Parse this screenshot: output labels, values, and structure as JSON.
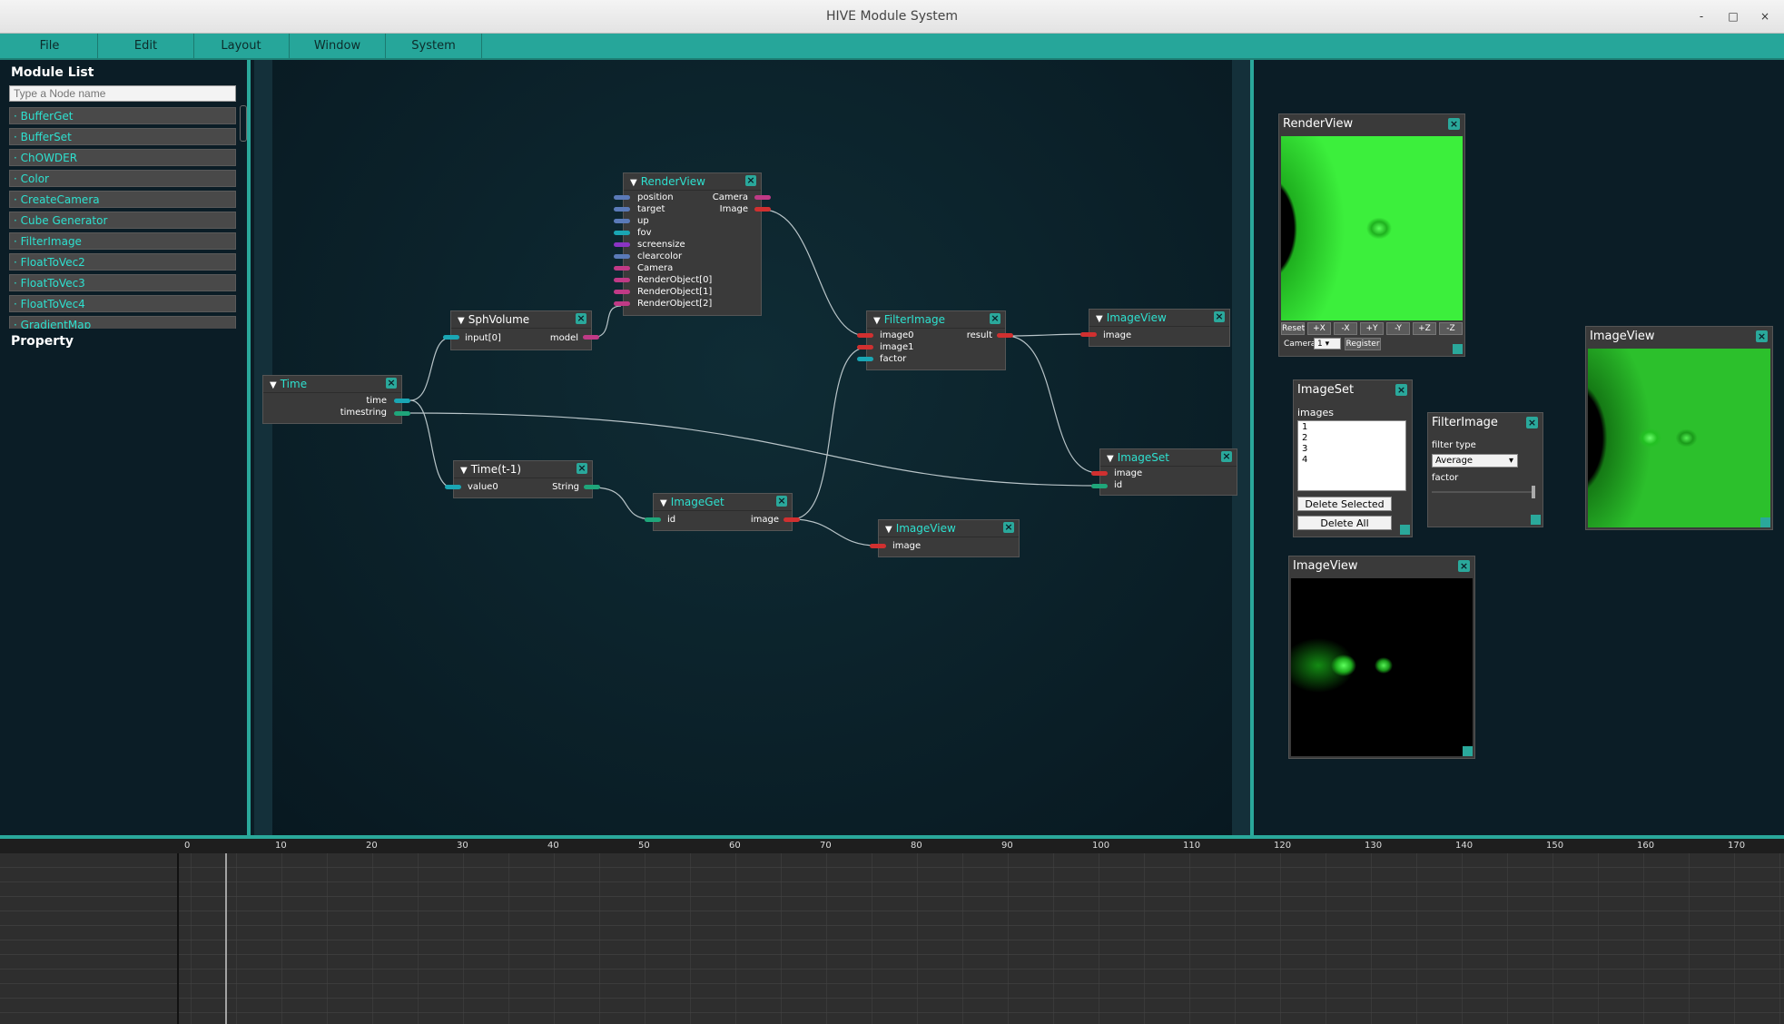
{
  "window": {
    "title": "HIVE Module System",
    "min": "-",
    "max": "□",
    "close": "×"
  },
  "menu": [
    "File",
    "Edit",
    "Layout",
    "Window",
    "System"
  ],
  "left_panel": {
    "module_list_title": "Module List",
    "search_placeholder": "Type a Node name",
    "modules": [
      "BufferGet",
      "BufferSet",
      "ChOWDER",
      "Color",
      "CreateCamera",
      "Cube Generator",
      "FilterImage",
      "FloatToVec2",
      "FloatToVec3",
      "FloatToVec4",
      "GradientMap"
    ],
    "property_title": "Property"
  },
  "nodes": {
    "renderview": {
      "title": "RenderView",
      "inputs": [
        "position",
        "target",
        "up",
        "fov",
        "screensize",
        "clearcolor",
        "Camera",
        "RenderObject[0]",
        "RenderObject[1]",
        "RenderObject[2]"
      ],
      "outputs": [
        "Camera",
        "Image"
      ]
    },
    "sphvolume": {
      "title": "SphVolume",
      "inputs": [
        "input[0]"
      ],
      "outputs": [
        "model"
      ]
    },
    "time": {
      "title": "Time",
      "outputs": [
        "time",
        "timestring"
      ]
    },
    "timet1": {
      "title": "Time(t-1)",
      "inputs": [
        "value0"
      ],
      "outputs": [
        "String"
      ]
    },
    "imageget": {
      "title": "ImageGet",
      "inputs": [
        "id"
      ],
      "outputs": [
        "image"
      ]
    },
    "filterimage": {
      "title": "FilterImage",
      "inputs": [
        "image0",
        "image1",
        "factor"
      ],
      "outputs": [
        "result"
      ]
    },
    "imageview1": {
      "title": "ImageView",
      "inputs": [
        "image"
      ]
    },
    "imageset": {
      "title": "ImageSet",
      "inputs": [
        "image",
        "id"
      ]
    },
    "imageview2": {
      "title": "ImageView",
      "inputs": [
        "image"
      ]
    }
  },
  "right_panel": {
    "renderview": {
      "title": "RenderView",
      "buttons": [
        "Reset",
        "+X",
        "-X",
        "+Y",
        "-Y",
        "+Z",
        "-Z"
      ],
      "camera_label": "Camera:",
      "camera_value": "1",
      "register": "Register"
    },
    "imageset": {
      "title": "ImageSet",
      "images_label": "images",
      "images": [
        "1",
        "2",
        "3",
        "4"
      ],
      "delete_selected": "Delete Selected",
      "delete_all": "Delete All"
    },
    "filterimage": {
      "title": "FilterImage",
      "filter_type_label": "filter type",
      "filter_type_value": "Average",
      "factor_label": "factor"
    },
    "imageview_a": {
      "title": "ImageView"
    },
    "imageview_b": {
      "title": "ImageView"
    }
  },
  "timeline": {
    "ticks": [
      "0",
      "10",
      "20",
      "30",
      "40",
      "50",
      "60",
      "70",
      "80",
      "90",
      "100",
      "110",
      "120",
      "130",
      "140",
      "150",
      "160",
      "170"
    ]
  },
  "colors": {
    "accent": "#2aa89b",
    "node_title": "#2ee0cf",
    "port_red": "#d03030",
    "port_magenta": "#c03a86",
    "port_teal": "#1aa6b4",
    "port_blue": "#5a7ab8",
    "port_green": "#1fa67a",
    "port_purple": "#8a34c4"
  }
}
